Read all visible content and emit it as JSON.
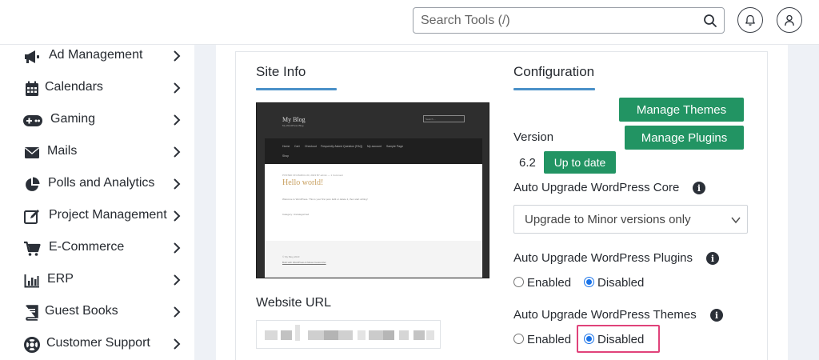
{
  "header": {
    "search_placeholder": "Search Tools (/)",
    "icons": [
      "search-icon",
      "bell-icon",
      "user-icon"
    ]
  },
  "sidebar": {
    "items": [
      {
        "label": "Ad Management",
        "icon": "megaphone-icon"
      },
      {
        "label": "Calendars",
        "icon": "calendar-icon"
      },
      {
        "label": "Gaming",
        "icon": "gamepad-icon"
      },
      {
        "label": "Mails",
        "icon": "envelope-icon"
      },
      {
        "label": "Polls and Analytics",
        "icon": "pie-chart-icon"
      },
      {
        "label": "Project Management",
        "icon": "edit-icon"
      },
      {
        "label": "E-Commerce",
        "icon": "cart-icon"
      },
      {
        "label": "ERP",
        "icon": "bar-chart-icon"
      },
      {
        "label": "Guest Books",
        "icon": "book-icon"
      },
      {
        "label": "Customer Support",
        "icon": "lifebuoy-icon"
      }
    ]
  },
  "site_info": {
    "title": "Site Info",
    "preview": {
      "blog_title": "My Blog",
      "tagline": "My WordPress Blog",
      "search_placeholder": "Search ...",
      "nav": [
        "Home",
        "Cart",
        "Checkout",
        "Frequently Asked Question (FAQ)",
        "My account",
        "Sample Page",
        "Shop"
      ],
      "post_meta": "POSTED ON MARCH 20, 2023 BY admin — 1 Comment",
      "post_title": "Hello world!",
      "post_body": "Welcome to WordPress. This is your first post. Edit or delete it, then start writing!",
      "post_category": "Category: Uncategorized",
      "footer_copy": "© My Blog 2023",
      "footer_link": "Built with WordPress & Mesa Customizer"
    },
    "website_url_label": "Website URL"
  },
  "configuration": {
    "title": "Configuration",
    "manage_themes": "Manage Themes",
    "manage_plugins": "Manage Plugins",
    "version_label": "Version",
    "version_value": "6.2",
    "up_to_date": "Up to date",
    "core_label": "Auto Upgrade WordPress Core",
    "core_selected": "Upgrade to Minor versions only",
    "plugins_label": "Auto Upgrade WordPress Plugins",
    "plugins": {
      "enabled": "Enabled",
      "disabled": "Disabled",
      "selected": "Disabled"
    },
    "themes_label": "Auto Upgrade WordPress Themes",
    "themes": {
      "enabled": "Enabled",
      "disabled": "Disabled",
      "selected": "Disabled"
    }
  },
  "colors": {
    "accent_green": "#229463",
    "underline_blue": "#4a90c8",
    "highlight_pink": "#e0427a",
    "radio_blue": "#1a73e8"
  }
}
